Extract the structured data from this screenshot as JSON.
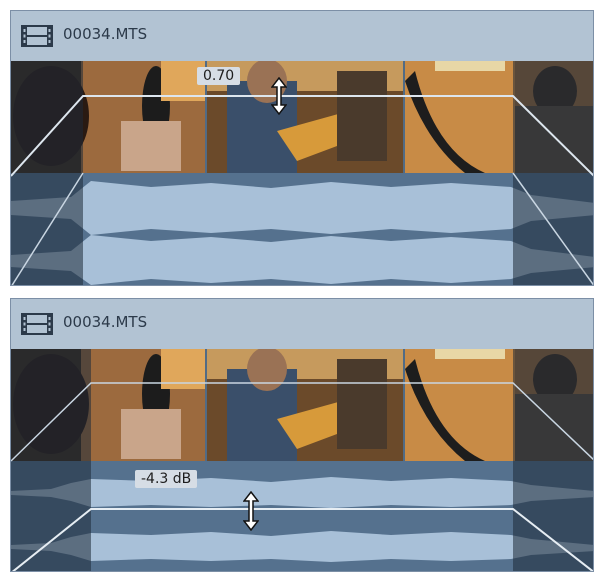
{
  "clips": [
    {
      "title": "00034.MTS",
      "icon": "film-strip-icon",
      "mode": "video-opacity",
      "value_label": "0.70",
      "cursor_icon": "vertical-resize-cursor-icon"
    },
    {
      "title": "00034.MTS",
      "icon": "film-strip-icon",
      "mode": "audio-volume",
      "value_label": "-4.3 dB",
      "cursor_icon": "vertical-resize-cursor-icon"
    }
  ],
  "colors": {
    "header_bg": "#b2c3d3",
    "wave_bg": "#55718e",
    "wave_fg": "#a8c0d8",
    "envelope_line": "#dde6ee"
  }
}
